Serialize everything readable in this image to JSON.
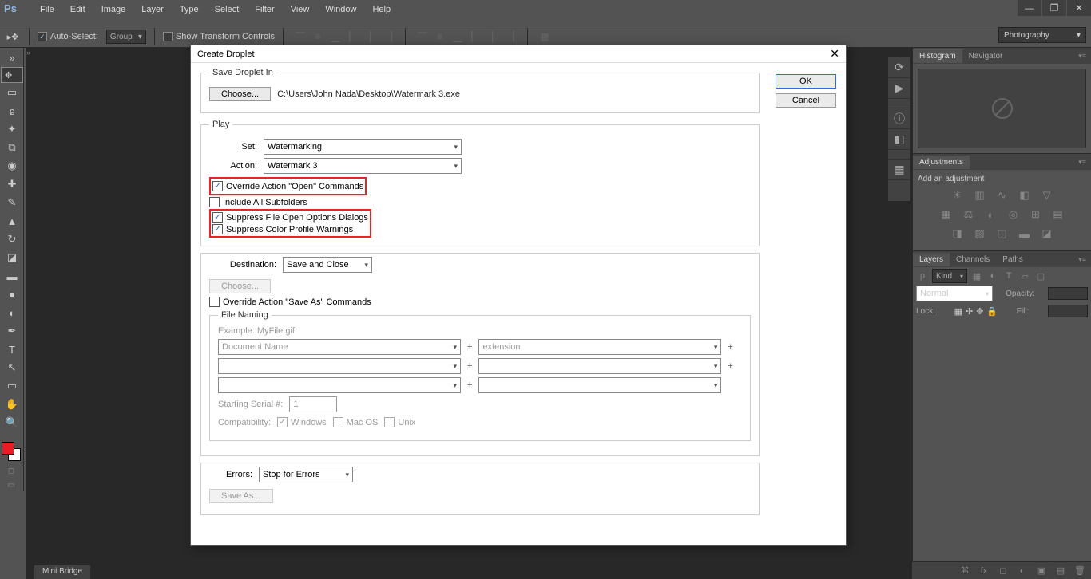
{
  "app": {
    "logo": "Ps"
  },
  "window_controls": {
    "min": "—",
    "max": "❐",
    "close": "✕"
  },
  "menu": [
    "File",
    "Edit",
    "Image",
    "Layer",
    "Type",
    "Select",
    "Filter",
    "View",
    "Window",
    "Help"
  ],
  "options": {
    "auto_select": "Auto-Select:",
    "group": "Group",
    "show_transform": "Show Transform Controls"
  },
  "workspace": "Photography",
  "panels": {
    "histogram_tab": "Histogram",
    "navigator_tab": "Navigator",
    "adjustments_tab": "Adjustments",
    "add_adjustment": "Add an adjustment",
    "layers_tab": "Layers",
    "channels_tab": "Channels",
    "paths_tab": "Paths",
    "kind": "Kind",
    "blend_mode": "Normal",
    "opacity_label": "Opacity:",
    "lock_label": "Lock:",
    "fill_label": "Fill:"
  },
  "mini_bridge": "Mini Bridge",
  "dialog": {
    "title": "Create Droplet",
    "ok": "OK",
    "cancel": "Cancel",
    "save_in_legend": "Save Droplet In",
    "choose": "Choose...",
    "path": "C:\\Users\\John Nada\\Desktop\\Watermark 3.exe",
    "play_legend": "Play",
    "set_label": "Set:",
    "set_value": "Watermarking",
    "action_label": "Action:",
    "action_value": "Watermark 3",
    "override_open": "Override Action \"Open\" Commands",
    "include_subfolders": "Include All Subfolders",
    "suppress_open": "Suppress File Open Options Dialogs",
    "suppress_color": "Suppress Color Profile Warnings",
    "dest_label": "Destination:",
    "dest_value": "Save and Close",
    "choose2": "Choose...",
    "override_saveas": "Override Action \"Save As\" Commands",
    "file_naming_legend": "File Naming",
    "example": "Example: MyFile.gif",
    "fn1": "Document Name",
    "fn2": "extension",
    "starting_serial": "Starting Serial #:",
    "starting_serial_val": "1",
    "compat": "Compatibility:",
    "compat_win": "Windows",
    "compat_mac": "Mac OS",
    "compat_unix": "Unix",
    "errors_label": "Errors:",
    "errors_value": "Stop for Errors",
    "save_as": "Save As..."
  }
}
